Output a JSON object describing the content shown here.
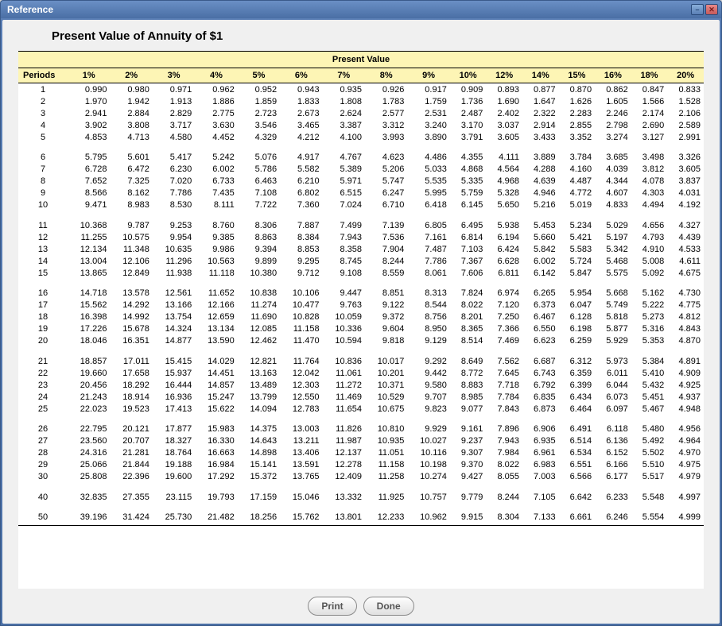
{
  "window": {
    "title": "Reference"
  },
  "page": {
    "title": "Present Value of Annuity of $1",
    "header_spanning": "Present Value"
  },
  "columns": {
    "periods_label": "Periods",
    "rates": [
      "1%",
      "2%",
      "3%",
      "4%",
      "5%",
      "6%",
      "7%",
      "8%",
      "9%",
      "10%",
      "12%",
      "14%",
      "15%",
      "16%",
      "18%",
      "20%"
    ]
  },
  "rows": [
    {
      "period": "1",
      "values": [
        "0.990",
        "0.980",
        "0.971",
        "0.962",
        "0.952",
        "0.943",
        "0.935",
        "0.926",
        "0.917",
        "0.909",
        "0.893",
        "0.877",
        "0.870",
        "0.862",
        "0.847",
        "0.833"
      ],
      "gap": false
    },
    {
      "period": "2",
      "values": [
        "1.970",
        "1.942",
        "1.913",
        "1.886",
        "1.859",
        "1.833",
        "1.808",
        "1.783",
        "1.759",
        "1.736",
        "1.690",
        "1.647",
        "1.626",
        "1.605",
        "1.566",
        "1.528"
      ],
      "gap": false
    },
    {
      "period": "3",
      "values": [
        "2.941",
        "2.884",
        "2.829",
        "2.775",
        "2.723",
        "2.673",
        "2.624",
        "2.577",
        "2.531",
        "2.487",
        "2.402",
        "2.322",
        "2.283",
        "2.246",
        "2.174",
        "2.106"
      ],
      "gap": false
    },
    {
      "period": "4",
      "values": [
        "3.902",
        "3.808",
        "3.717",
        "3.630",
        "3.546",
        "3.465",
        "3.387",
        "3.312",
        "3.240",
        "3.170",
        "3.037",
        "2.914",
        "2.855",
        "2.798",
        "2.690",
        "2.589"
      ],
      "gap": false
    },
    {
      "period": "5",
      "values": [
        "4.853",
        "4.713",
        "4.580",
        "4.452",
        "4.329",
        "4.212",
        "4.100",
        "3.993",
        "3.890",
        "3.791",
        "3.605",
        "3.433",
        "3.352",
        "3.274",
        "3.127",
        "2.991"
      ],
      "gap": false
    },
    {
      "period": "6",
      "values": [
        "5.795",
        "5.601",
        "5.417",
        "5.242",
        "5.076",
        "4.917",
        "4.767",
        "4.623",
        "4.486",
        "4.355",
        "4.111",
        "3.889",
        "3.784",
        "3.685",
        "3.498",
        "3.326"
      ],
      "gap": true
    },
    {
      "period": "7",
      "values": [
        "6.728",
        "6.472",
        "6.230",
        "6.002",
        "5.786",
        "5.582",
        "5.389",
        "5.206",
        "5.033",
        "4.868",
        "4.564",
        "4.288",
        "4.160",
        "4.039",
        "3.812",
        "3.605"
      ],
      "gap": false
    },
    {
      "period": "8",
      "values": [
        "7.652",
        "7.325",
        "7.020",
        "6.733",
        "6.463",
        "6.210",
        "5.971",
        "5.747",
        "5.535",
        "5.335",
        "4.968",
        "4.639",
        "4.487",
        "4.344",
        "4.078",
        "3.837"
      ],
      "gap": false
    },
    {
      "period": "9",
      "values": [
        "8.566",
        "8.162",
        "7.786",
        "7.435",
        "7.108",
        "6.802",
        "6.515",
        "6.247",
        "5.995",
        "5.759",
        "5.328",
        "4.946",
        "4.772",
        "4.607",
        "4.303",
        "4.031"
      ],
      "gap": false
    },
    {
      "period": "10",
      "values": [
        "9.471",
        "8.983",
        "8.530",
        "8.111",
        "7.722",
        "7.360",
        "7.024",
        "6.710",
        "6.418",
        "6.145",
        "5.650",
        "5.216",
        "5.019",
        "4.833",
        "4.494",
        "4.192"
      ],
      "gap": false
    },
    {
      "period": "11",
      "values": [
        "10.368",
        "9.787",
        "9.253",
        "8.760",
        "8.306",
        "7.887",
        "7.499",
        "7.139",
        "6.805",
        "6.495",
        "5.938",
        "5.453",
        "5.234",
        "5.029",
        "4.656",
        "4.327"
      ],
      "gap": true
    },
    {
      "period": "12",
      "values": [
        "11.255",
        "10.575",
        "9.954",
        "9.385",
        "8.863",
        "8.384",
        "7.943",
        "7.536",
        "7.161",
        "6.814",
        "6.194",
        "5.660",
        "5.421",
        "5.197",
        "4.793",
        "4.439"
      ],
      "gap": false
    },
    {
      "period": "13",
      "values": [
        "12.134",
        "11.348",
        "10.635",
        "9.986",
        "9.394",
        "8.853",
        "8.358",
        "7.904",
        "7.487",
        "7.103",
        "6.424",
        "5.842",
        "5.583",
        "5.342",
        "4.910",
        "4.533"
      ],
      "gap": false
    },
    {
      "period": "14",
      "values": [
        "13.004",
        "12.106",
        "11.296",
        "10.563",
        "9.899",
        "9.295",
        "8.745",
        "8.244",
        "7.786",
        "7.367",
        "6.628",
        "6.002",
        "5.724",
        "5.468",
        "5.008",
        "4.611"
      ],
      "gap": false
    },
    {
      "period": "15",
      "values": [
        "13.865",
        "12.849",
        "11.938",
        "11.118",
        "10.380",
        "9.712",
        "9.108",
        "8.559",
        "8.061",
        "7.606",
        "6.811",
        "6.142",
        "5.847",
        "5.575",
        "5.092",
        "4.675"
      ],
      "gap": false
    },
    {
      "period": "16",
      "values": [
        "14.718",
        "13.578",
        "12.561",
        "11.652",
        "10.838",
        "10.106",
        "9.447",
        "8.851",
        "8.313",
        "7.824",
        "6.974",
        "6.265",
        "5.954",
        "5.668",
        "5.162",
        "4.730"
      ],
      "gap": true
    },
    {
      "period": "17",
      "values": [
        "15.562",
        "14.292",
        "13.166",
        "12.166",
        "11.274",
        "10.477",
        "9.763",
        "9.122",
        "8.544",
        "8.022",
        "7.120",
        "6.373",
        "6.047",
        "5.749",
        "5.222",
        "4.775"
      ],
      "gap": false
    },
    {
      "period": "18",
      "values": [
        "16.398",
        "14.992",
        "13.754",
        "12.659",
        "11.690",
        "10.828",
        "10.059",
        "9.372",
        "8.756",
        "8.201",
        "7.250",
        "6.467",
        "6.128",
        "5.818",
        "5.273",
        "4.812"
      ],
      "gap": false
    },
    {
      "period": "19",
      "values": [
        "17.226",
        "15.678",
        "14.324",
        "13.134",
        "12.085",
        "11.158",
        "10.336",
        "9.604",
        "8.950",
        "8.365",
        "7.366",
        "6.550",
        "6.198",
        "5.877",
        "5.316",
        "4.843"
      ],
      "gap": false
    },
    {
      "period": "20",
      "values": [
        "18.046",
        "16.351",
        "14.877",
        "13.590",
        "12.462",
        "11.470",
        "10.594",
        "9.818",
        "9.129",
        "8.514",
        "7.469",
        "6.623",
        "6.259",
        "5.929",
        "5.353",
        "4.870"
      ],
      "gap": false
    },
    {
      "period": "21",
      "values": [
        "18.857",
        "17.011",
        "15.415",
        "14.029",
        "12.821",
        "11.764",
        "10.836",
        "10.017",
        "9.292",
        "8.649",
        "7.562",
        "6.687",
        "6.312",
        "5.973",
        "5.384",
        "4.891"
      ],
      "gap": true
    },
    {
      "period": "22",
      "values": [
        "19.660",
        "17.658",
        "15.937",
        "14.451",
        "13.163",
        "12.042",
        "11.061",
        "10.201",
        "9.442",
        "8.772",
        "7.645",
        "6.743",
        "6.359",
        "6.011",
        "5.410",
        "4.909"
      ],
      "gap": false
    },
    {
      "period": "23",
      "values": [
        "20.456",
        "18.292",
        "16.444",
        "14.857",
        "13.489",
        "12.303",
        "11.272",
        "10.371",
        "9.580",
        "8.883",
        "7.718",
        "6.792",
        "6.399",
        "6.044",
        "5.432",
        "4.925"
      ],
      "gap": false
    },
    {
      "period": "24",
      "values": [
        "21.243",
        "18.914",
        "16.936",
        "15.247",
        "13.799",
        "12.550",
        "11.469",
        "10.529",
        "9.707",
        "8.985",
        "7.784",
        "6.835",
        "6.434",
        "6.073",
        "5.451",
        "4.937"
      ],
      "gap": false
    },
    {
      "period": "25",
      "values": [
        "22.023",
        "19.523",
        "17.413",
        "15.622",
        "14.094",
        "12.783",
        "11.654",
        "10.675",
        "9.823",
        "9.077",
        "7.843",
        "6.873",
        "6.464",
        "6.097",
        "5.467",
        "4.948"
      ],
      "gap": false
    },
    {
      "period": "26",
      "values": [
        "22.795",
        "20.121",
        "17.877",
        "15.983",
        "14.375",
        "13.003",
        "11.826",
        "10.810",
        "9.929",
        "9.161",
        "7.896",
        "6.906",
        "6.491",
        "6.118",
        "5.480",
        "4.956"
      ],
      "gap": true
    },
    {
      "period": "27",
      "values": [
        "23.560",
        "20.707",
        "18.327",
        "16.330",
        "14.643",
        "13.211",
        "11.987",
        "10.935",
        "10.027",
        "9.237",
        "7.943",
        "6.935",
        "6.514",
        "6.136",
        "5.492",
        "4.964"
      ],
      "gap": false
    },
    {
      "period": "28",
      "values": [
        "24.316",
        "21.281",
        "18.764",
        "16.663",
        "14.898",
        "13.406",
        "12.137",
        "11.051",
        "10.116",
        "9.307",
        "7.984",
        "6.961",
        "6.534",
        "6.152",
        "5.502",
        "4.970"
      ],
      "gap": false
    },
    {
      "period": "29",
      "values": [
        "25.066",
        "21.844",
        "19.188",
        "16.984",
        "15.141",
        "13.591",
        "12.278",
        "11.158",
        "10.198",
        "9.370",
        "8.022",
        "6.983",
        "6.551",
        "6.166",
        "5.510",
        "4.975"
      ],
      "gap": false
    },
    {
      "period": "30",
      "values": [
        "25.808",
        "22.396",
        "19.600",
        "17.292",
        "15.372",
        "13.765",
        "12.409",
        "11.258",
        "10.274",
        "9.427",
        "8.055",
        "7.003",
        "6.566",
        "6.177",
        "5.517",
        "4.979"
      ],
      "gap": false
    },
    {
      "period": "40",
      "values": [
        "32.835",
        "27.355",
        "23.115",
        "19.793",
        "17.159",
        "15.046",
        "13.332",
        "11.925",
        "10.757",
        "9.779",
        "8.244",
        "7.105",
        "6.642",
        "6.233",
        "5.548",
        "4.997"
      ],
      "gap": true
    },
    {
      "period": "50",
      "values": [
        "39.196",
        "31.424",
        "25.730",
        "21.482",
        "18.256",
        "15.762",
        "13.801",
        "12.233",
        "10.962",
        "9.915",
        "8.304",
        "7.133",
        "6.661",
        "6.246",
        "5.554",
        "4.999"
      ],
      "gap": true
    }
  ],
  "buttons": {
    "print": "Print",
    "done": "Done"
  }
}
